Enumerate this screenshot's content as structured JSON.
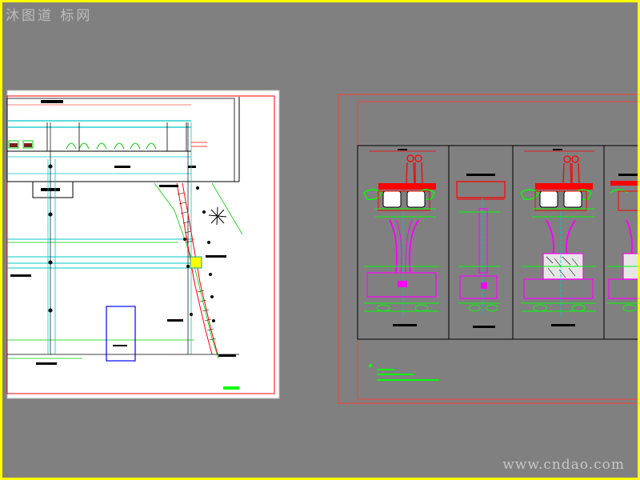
{
  "watermark_top": "沐图道 标网",
  "watermark_bottom": "www.cndao.com",
  "colors": {
    "canvas": "#808080",
    "frame": "#ffff00",
    "paper": "#ffffff",
    "red": "#ff0000",
    "green": "#00ff00",
    "cyan": "#00ffff",
    "magenta": "#ff00ff",
    "blue": "#0000ff",
    "yellow": "#ffff00"
  }
}
